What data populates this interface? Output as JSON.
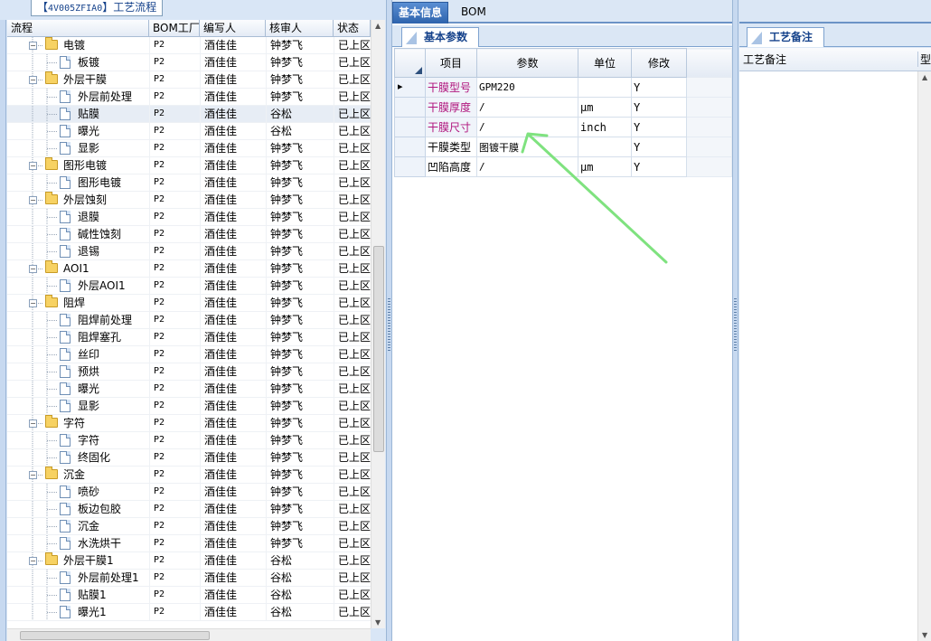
{
  "left": {
    "title_prefix": "【",
    "title_code": "4V005ZFIA0",
    "title_suffix": "】工艺流程",
    "columns": [
      "流程",
      "BOM工厂",
      "编写人",
      "核审人",
      "状态"
    ],
    "rows": [
      {
        "level": 1,
        "type": "folder",
        "label": "电镀",
        "factory": "P2",
        "writer": "酒佳佳",
        "reviewer": "钟梦飞",
        "status": "已上区"
      },
      {
        "level": 2,
        "type": "doc",
        "label": "板镀",
        "factory": "P2",
        "writer": "酒佳佳",
        "reviewer": "钟梦飞",
        "status": "已上区"
      },
      {
        "level": 1,
        "type": "folder",
        "label": "外层干膜",
        "factory": "P2",
        "writer": "酒佳佳",
        "reviewer": "钟梦飞",
        "status": "已上区"
      },
      {
        "level": 2,
        "type": "doc",
        "label": "外层前处理",
        "factory": "P2",
        "writer": "酒佳佳",
        "reviewer": "钟梦飞",
        "status": "已上区"
      },
      {
        "level": 2,
        "type": "doc",
        "label": "贴膜",
        "factory": "P2",
        "writer": "酒佳佳",
        "reviewer": "谷松",
        "status": "已上区",
        "selected": true
      },
      {
        "level": 2,
        "type": "doc",
        "label": "曝光",
        "factory": "P2",
        "writer": "酒佳佳",
        "reviewer": "谷松",
        "status": "已上区"
      },
      {
        "level": 2,
        "type": "doc",
        "label": "显影",
        "factory": "P2",
        "writer": "酒佳佳",
        "reviewer": "钟梦飞",
        "status": "已上区"
      },
      {
        "level": 1,
        "type": "folder",
        "label": "图形电镀",
        "factory": "P2",
        "writer": "酒佳佳",
        "reviewer": "钟梦飞",
        "status": "已上区"
      },
      {
        "level": 2,
        "type": "doc",
        "label": "图形电镀",
        "factory": "P2",
        "writer": "酒佳佳",
        "reviewer": "钟梦飞",
        "status": "已上区"
      },
      {
        "level": 1,
        "type": "folder",
        "label": "外层蚀刻",
        "factory": "P2",
        "writer": "酒佳佳",
        "reviewer": "钟梦飞",
        "status": "已上区"
      },
      {
        "level": 2,
        "type": "doc",
        "label": "退膜",
        "factory": "P2",
        "writer": "酒佳佳",
        "reviewer": "钟梦飞",
        "status": "已上区"
      },
      {
        "level": 2,
        "type": "doc",
        "label": "碱性蚀刻",
        "factory": "P2",
        "writer": "酒佳佳",
        "reviewer": "钟梦飞",
        "status": "已上区"
      },
      {
        "level": 2,
        "type": "doc",
        "label": "退锡",
        "factory": "P2",
        "writer": "酒佳佳",
        "reviewer": "钟梦飞",
        "status": "已上区"
      },
      {
        "level": 1,
        "type": "folder",
        "label": "AOI1",
        "factory": "P2",
        "writer": "酒佳佳",
        "reviewer": "钟梦飞",
        "status": "已上区"
      },
      {
        "level": 2,
        "type": "doc",
        "label": "外层AOI1",
        "factory": "P2",
        "writer": "酒佳佳",
        "reviewer": "钟梦飞",
        "status": "已上区"
      },
      {
        "level": 1,
        "type": "folder",
        "label": "阻焊",
        "factory": "P2",
        "writer": "酒佳佳",
        "reviewer": "钟梦飞",
        "status": "已上区"
      },
      {
        "level": 2,
        "type": "doc",
        "label": "阻焊前处理",
        "factory": "P2",
        "writer": "酒佳佳",
        "reviewer": "钟梦飞",
        "status": "已上区"
      },
      {
        "level": 2,
        "type": "doc",
        "label": "阻焊塞孔",
        "factory": "P2",
        "writer": "酒佳佳",
        "reviewer": "钟梦飞",
        "status": "已上区"
      },
      {
        "level": 2,
        "type": "doc",
        "label": "丝印",
        "factory": "P2",
        "writer": "酒佳佳",
        "reviewer": "钟梦飞",
        "status": "已上区"
      },
      {
        "level": 2,
        "type": "doc",
        "label": "预烘",
        "factory": "P2",
        "writer": "酒佳佳",
        "reviewer": "钟梦飞",
        "status": "已上区"
      },
      {
        "level": 2,
        "type": "doc",
        "label": "曝光",
        "factory": "P2",
        "writer": "酒佳佳",
        "reviewer": "钟梦飞",
        "status": "已上区"
      },
      {
        "level": 2,
        "type": "doc",
        "label": "显影",
        "factory": "P2",
        "writer": "酒佳佳",
        "reviewer": "钟梦飞",
        "status": "已上区"
      },
      {
        "level": 1,
        "type": "folder",
        "label": "字符",
        "factory": "P2",
        "writer": "酒佳佳",
        "reviewer": "钟梦飞",
        "status": "已上区"
      },
      {
        "level": 2,
        "type": "doc",
        "label": "字符",
        "factory": "P2",
        "writer": "酒佳佳",
        "reviewer": "钟梦飞",
        "status": "已上区"
      },
      {
        "level": 2,
        "type": "doc",
        "label": "终固化",
        "factory": "P2",
        "writer": "酒佳佳",
        "reviewer": "钟梦飞",
        "status": "已上区"
      },
      {
        "level": 1,
        "type": "folder",
        "label": "沉金",
        "factory": "P2",
        "writer": "酒佳佳",
        "reviewer": "钟梦飞",
        "status": "已上区"
      },
      {
        "level": 2,
        "type": "doc",
        "label": "喷砂",
        "factory": "P2",
        "writer": "酒佳佳",
        "reviewer": "钟梦飞",
        "status": "已上区"
      },
      {
        "level": 2,
        "type": "doc",
        "label": "板边包胶",
        "factory": "P2",
        "writer": "酒佳佳",
        "reviewer": "钟梦飞",
        "status": "已上区"
      },
      {
        "level": 2,
        "type": "doc",
        "label": "沉金",
        "factory": "P2",
        "writer": "酒佳佳",
        "reviewer": "钟梦飞",
        "status": "已上区"
      },
      {
        "level": 2,
        "type": "doc",
        "label": "水洗烘干",
        "factory": "P2",
        "writer": "酒佳佳",
        "reviewer": "钟梦飞",
        "status": "已上区"
      },
      {
        "level": 1,
        "type": "folder",
        "label": "外层干膜1",
        "factory": "P2",
        "writer": "酒佳佳",
        "reviewer": "谷松",
        "status": "已上区"
      },
      {
        "level": 2,
        "type": "doc",
        "label": "外层前处理1",
        "factory": "P2",
        "writer": "酒佳佳",
        "reviewer": "谷松",
        "status": "已上区"
      },
      {
        "level": 2,
        "type": "doc",
        "label": "贴膜1",
        "factory": "P2",
        "writer": "酒佳佳",
        "reviewer": "谷松",
        "status": "已上区"
      },
      {
        "level": 2,
        "type": "doc",
        "label": "曝光1",
        "factory": "P2",
        "writer": "酒佳佳",
        "reviewer": "谷松",
        "status": "已上区"
      }
    ]
  },
  "middle": {
    "tabs": [
      "基本信息",
      "BOM"
    ],
    "active_tab": 0,
    "subtab": "基本参数",
    "param_columns": [
      "项目",
      "参数",
      "单位",
      "修改"
    ],
    "params": [
      {
        "item": "干膜型号",
        "value": "GPM220",
        "unit": "",
        "modify": "Y",
        "highlight": true,
        "current": true
      },
      {
        "item": "干膜厚度",
        "value": "/",
        "unit": "μm",
        "modify": "Y",
        "highlight": true
      },
      {
        "item": "干膜尺寸",
        "value": "/",
        "unit": "inch",
        "modify": "Y",
        "highlight": true
      },
      {
        "item": "干膜类型",
        "value": "图镀干膜",
        "unit": "",
        "modify": "Y",
        "highlight": false
      },
      {
        "item": "凹陷高度",
        "value": "/",
        "unit": "μm",
        "modify": "Y",
        "highlight": false
      }
    ]
  },
  "right": {
    "tab": "工艺备注",
    "column": "工艺备注",
    "column2": "型"
  },
  "colors": {
    "accent": "#2e63ad",
    "highlight_text": "#b0157d",
    "annotation_arrow": "#7fe27f"
  }
}
